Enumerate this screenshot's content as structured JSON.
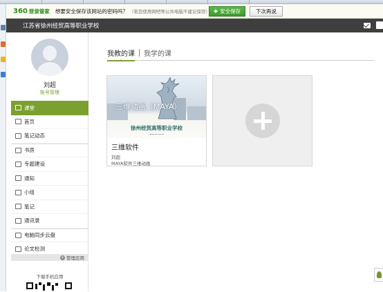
{
  "password_bar": {
    "brand": "360",
    "brand_sub": "登录管家",
    "question": "想要安全保存该网站的密码吗？",
    "note": "（若您使用网吧等公共电脑不建议保存）",
    "save_label": "安全保存",
    "later_label": "下次再说"
  },
  "header": {
    "school_name": "江苏省徐州经贸高等职业学校"
  },
  "user": {
    "name": "刘超",
    "account_link": "账号管理"
  },
  "nav": {
    "items": [
      {
        "label": "课堂",
        "icon": "classroom-icon",
        "active": true
      },
      {
        "label": "首页",
        "icon": "home-icon"
      },
      {
        "label": "笔记动态",
        "icon": "notes-feed-icon"
      },
      {
        "label": "书房",
        "icon": "study-icon"
      },
      {
        "label": "专题建设",
        "icon": "topic-icon"
      },
      {
        "label": "通知",
        "icon": "notice-icon"
      },
      {
        "label": "小组",
        "icon": "group-icon"
      },
      {
        "label": "笔记",
        "icon": "note-icon"
      },
      {
        "label": "通讯录",
        "icon": "contacts-icon"
      },
      {
        "label": "电脑同步云盘",
        "icon": "cloud-icon"
      },
      {
        "label": "论文检测",
        "icon": "paper-check-icon"
      }
    ],
    "manage_apps": "管理应用",
    "download_app": "下载手机应用"
  },
  "tabs": {
    "teaching": "我教的课",
    "learning": "我学的课"
  },
  "course": {
    "cover_title": "三维动画（MAYA）",
    "cover_school": "徐州经贸高等职业学校",
    "title": "三维软件",
    "teacher": "刘超",
    "description": "MAYA软件三维动画"
  },
  "colors": {
    "accent": "#7ca02f",
    "header_bg": "#3f3f3f",
    "save_button": "#4aa83a"
  }
}
